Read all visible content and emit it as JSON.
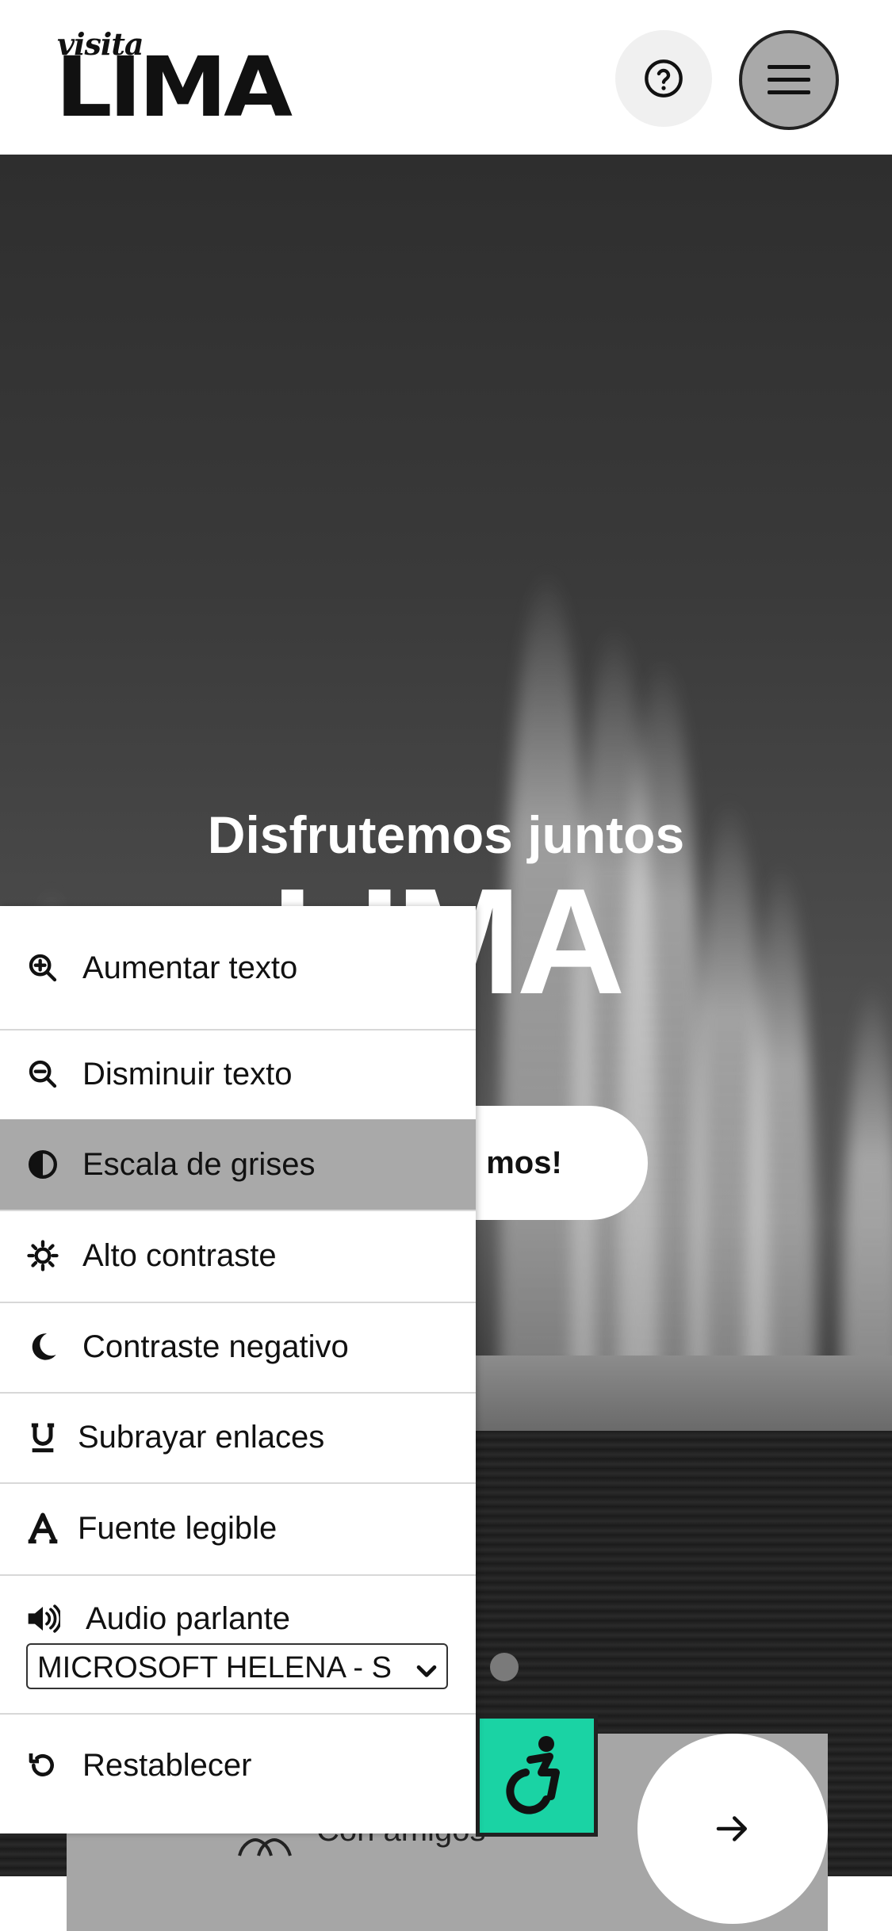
{
  "header": {
    "logo_script": "visita",
    "logo_main": "LIMA",
    "help_icon": "help-circle-icon",
    "menu_icon": "hamburger-menu-icon"
  },
  "hero": {
    "subtitle": "Disfrutemos juntos",
    "title": "LIMA",
    "cta_label": "mos!"
  },
  "bottom_card": {
    "label": "Con amigos",
    "icon": "people-icon",
    "next_icon": "arrow-right-icon"
  },
  "accessibility_button": {
    "icon": "wheelchair-icon",
    "color": "#1ad3a4"
  },
  "panel": {
    "items": [
      {
        "label": "Aumentar texto",
        "icon": "zoom-in-icon"
      },
      {
        "label": "Disminuir texto",
        "icon": "zoom-out-icon"
      },
      {
        "label": "Escala de grises",
        "icon": "half-circle-icon",
        "active": true
      },
      {
        "label": "Alto contraste",
        "icon": "sun-icon"
      },
      {
        "label": "Contraste negativo",
        "icon": "moon-icon"
      },
      {
        "label": "Subrayar enlaces",
        "icon": "underline-icon"
      },
      {
        "label": "Fuente legible",
        "icon": "font-icon"
      },
      {
        "label": "Audio parlante",
        "icon": "speaker-icon"
      },
      {
        "label": "Restablecer",
        "icon": "reset-icon"
      }
    ],
    "voice_select_value": "MICROSOFT HELENA - S"
  },
  "colors": {
    "active_item_bg": "#a9a9a9",
    "accent": "#1ad3a4"
  }
}
